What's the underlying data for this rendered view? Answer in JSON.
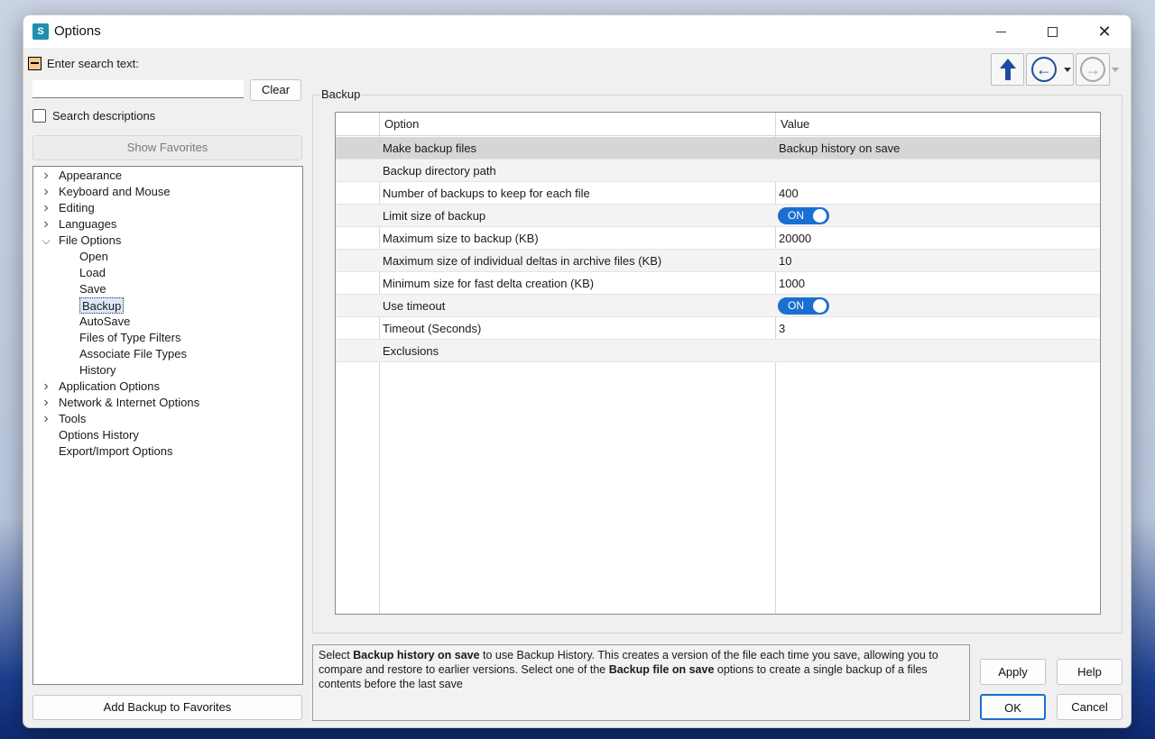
{
  "window": {
    "title": "Options",
    "icon_text": "S"
  },
  "search": {
    "label": "Enter search text:",
    "value": "",
    "clear_label": "Clear",
    "descriptions_label": "Search descriptions"
  },
  "favorites": {
    "show_label": "Show Favorites",
    "add_label": "Add Backup to Favorites"
  },
  "tree": [
    {
      "label": "Appearance",
      "level": 0,
      "chevron": "right"
    },
    {
      "label": "Keyboard and Mouse",
      "level": 0,
      "chevron": "right"
    },
    {
      "label": "Editing",
      "level": 0,
      "chevron": "right"
    },
    {
      "label": "Languages",
      "level": 0,
      "chevron": "right"
    },
    {
      "label": "File Options",
      "level": 0,
      "chevron": "down"
    },
    {
      "label": "Open",
      "level": 1
    },
    {
      "label": "Load",
      "level": 1
    },
    {
      "label": "Save",
      "level": 1
    },
    {
      "label": "Backup",
      "level": 1,
      "selected": true
    },
    {
      "label": "AutoSave",
      "level": 1
    },
    {
      "label": "Files of Type Filters",
      "level": 1
    },
    {
      "label": "Associate File Types",
      "level": 1
    },
    {
      "label": "History",
      "level": 1
    },
    {
      "label": "Application Options",
      "level": 0,
      "chevron": "right"
    },
    {
      "label": "Network & Internet Options",
      "level": 0,
      "chevron": "right"
    },
    {
      "label": "Tools",
      "level": 0,
      "chevron": "right"
    },
    {
      "label": "Options History",
      "level": 0
    },
    {
      "label": "Export/Import Options",
      "level": 0
    }
  ],
  "group": {
    "title": "Backup"
  },
  "grid": {
    "headers": {
      "option": "Option",
      "value": "Value"
    },
    "rows": [
      {
        "option": "Make backup files",
        "value": "Backup history on save",
        "selected": true
      },
      {
        "option": "Backup directory path",
        "value": ""
      },
      {
        "option": "Number of backups to keep for each file",
        "value": "400"
      },
      {
        "option": "Limit size of backup",
        "toggle": "ON"
      },
      {
        "option": "Maximum size to backup (KB)",
        "value": "20000"
      },
      {
        "option": "Maximum size of individual deltas in archive files (KB)",
        "value": "10"
      },
      {
        "option": "Minimum size for fast delta creation (KB)",
        "value": "1000"
      },
      {
        "option": "Use timeout",
        "toggle": "ON"
      },
      {
        "option": "Timeout (Seconds)",
        "value": "3"
      },
      {
        "option": "Exclusions",
        "value": ""
      }
    ]
  },
  "description": {
    "t1": "Select ",
    "b1": "Backup history on save",
    "t2": " to use Backup History. This creates a version of the file each time you save, allowing you to compare and restore to earlier versions. Select one of the ",
    "b2": "Backup file on save",
    "t3": " options to create a single backup of a files contents before the last save"
  },
  "buttons": {
    "apply": "Apply",
    "help": "Help",
    "ok": "OK",
    "cancel": "Cancel"
  },
  "colors": {
    "accent": "#1a6fd1",
    "nav_arrow": "#1f4b9c",
    "selected_row": "#d6d6d6"
  }
}
